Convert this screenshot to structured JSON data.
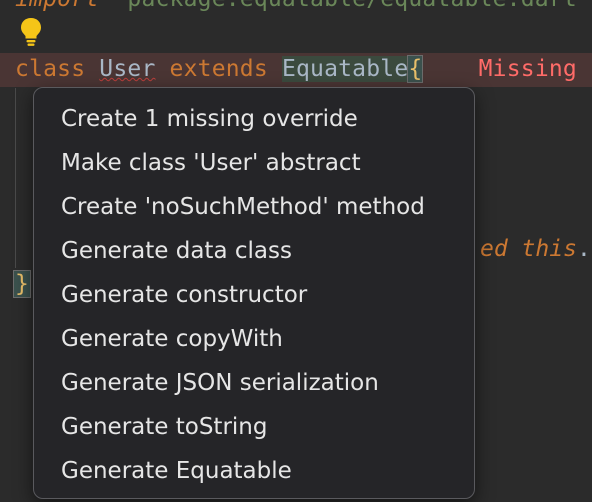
{
  "editor": {
    "import_line": {
      "keyword": "import",
      "path": "'package:equatable/equatable.dart';"
    },
    "class_line": {
      "kw_class": "class ",
      "class_name": "User",
      "kw_extends": " extends ",
      "super_type": "Equatable",
      "open_brace": "{",
      "error_text": "    Missing"
    },
    "trailing_text": {
      "keyword": "ed this",
      "dot": "."
    },
    "closing_brace": "}"
  },
  "context_menu": {
    "items": [
      "Create 1 missing override",
      "Make class 'User' abstract",
      "Create 'noSuchMethod' method",
      "Generate data class",
      "Generate constructor",
      "Generate copyWith",
      "Generate JSON serialization",
      "Generate toString",
      "Generate Equatable"
    ]
  },
  "icons": {
    "bulb": "lightbulb-icon"
  },
  "colors": {
    "background": "#2b2b2b",
    "popup_bg": "#252528",
    "keyword": "#cc7832",
    "error_line_bg": "#4a3534",
    "bulb": "#f5c518"
  }
}
